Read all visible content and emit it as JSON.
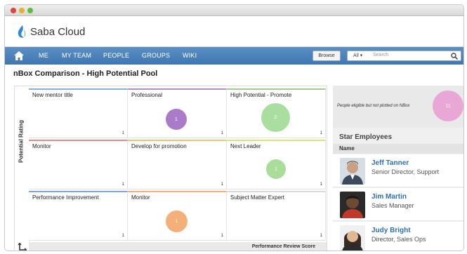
{
  "app": {
    "name": "Saba Cloud"
  },
  "nav": {
    "items": [
      "ME",
      "MY TEAM",
      "PEOPLE",
      "GROUPS",
      "WIKI"
    ],
    "browse_label": "Browse",
    "search_scope": "All",
    "search_placeholder": "Search"
  },
  "page": {
    "title": "nBox Comparison - High Potential Pool"
  },
  "grid": {
    "y_axis_label": "Potential Rating",
    "x_axis_label": "Performance Review Score",
    "cells": [
      {
        "title": "New mentor title",
        "count": "1",
        "color": "#7fb3e0"
      },
      {
        "title": "Professional",
        "count": "1",
        "color": "#b48bd0",
        "bubble": "1",
        "bubble_color": "#a97bc9"
      },
      {
        "title": "High Potential - Promote",
        "count": "1",
        "color": "#9bd38c",
        "bubble": "2",
        "bubble_color": "#a9deA0"
      },
      {
        "title": "Monitor",
        "count": "1",
        "color": "#e58a8a"
      },
      {
        "title": "Develop for promotion",
        "count": "1",
        "color": "#f0c46b"
      },
      {
        "title": "Next Leader",
        "count": "1",
        "color": "#e0e07a",
        "bubble": "1",
        "bubble_color": "#a8dd9a"
      },
      {
        "title": "Performance Improvement",
        "count": "1",
        "color": "#7fa8d8"
      },
      {
        "title": "Monitor",
        "count": "1",
        "color": "#f2b089",
        "bubble": "1",
        "bubble_color": "#f5b07a"
      },
      {
        "title": "Subject Matter Expert",
        "count": "1",
        "color": "#d9d9d9"
      }
    ]
  },
  "side": {
    "eligible_text": "People eligible but not plotted on NBox",
    "eligible_count": "11",
    "star_header": "Star Employees",
    "name_header": "Name",
    "employees": [
      {
        "name": "Jeff Tanner",
        "role": "Senior Director, Support"
      },
      {
        "name": "Jim Martin",
        "role": "Sales Manager"
      },
      {
        "name": "Judy Bright",
        "role": "Director, Sales Ops"
      }
    ]
  }
}
